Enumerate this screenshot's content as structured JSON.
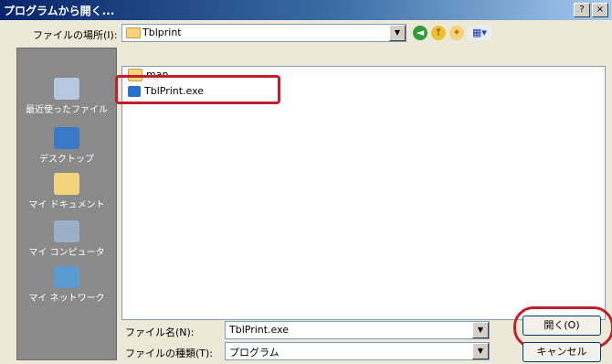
{
  "window": {
    "title": "プログラムから開く...",
    "help_button": "?",
    "close_button": "×"
  },
  "toolbar": {
    "lookin_label": "ファイルの場所(I):",
    "lookin_value": "Tblprint",
    "dropdown_glyph": "▼",
    "back_glyph": "◄",
    "up_glyph": "↑",
    "newfolder_glyph": "✦",
    "views_glyph": "▦▾"
  },
  "places": [
    {
      "label": "最近使ったファイル",
      "icon": "recent-documents-icon"
    },
    {
      "label": "デスクトップ",
      "icon": "desktop-icon"
    },
    {
      "label": "マイ ドキュメント",
      "icon": "my-documents-icon"
    },
    {
      "label": "マイ コンピュータ",
      "icon": "my-computer-icon"
    },
    {
      "label": "マイ ネットワーク",
      "icon": "my-network-icon"
    }
  ],
  "files": [
    {
      "name": "man",
      "icon": "folder-icon"
    },
    {
      "name": "TblPrint.exe",
      "icon": "exe-icon",
      "selected": true
    }
  ],
  "form": {
    "filename_label": "ファイル名(N):",
    "filename_value": "TblPrint.exe",
    "filetype_label": "ファイルの種類(T):",
    "filetype_value": "プログラム"
  },
  "buttons": {
    "open": "開く(O)",
    "cancel": "キャンセル"
  },
  "colors": {
    "highlight_ring": "#c0202c",
    "title_bar": "#0a246a"
  }
}
